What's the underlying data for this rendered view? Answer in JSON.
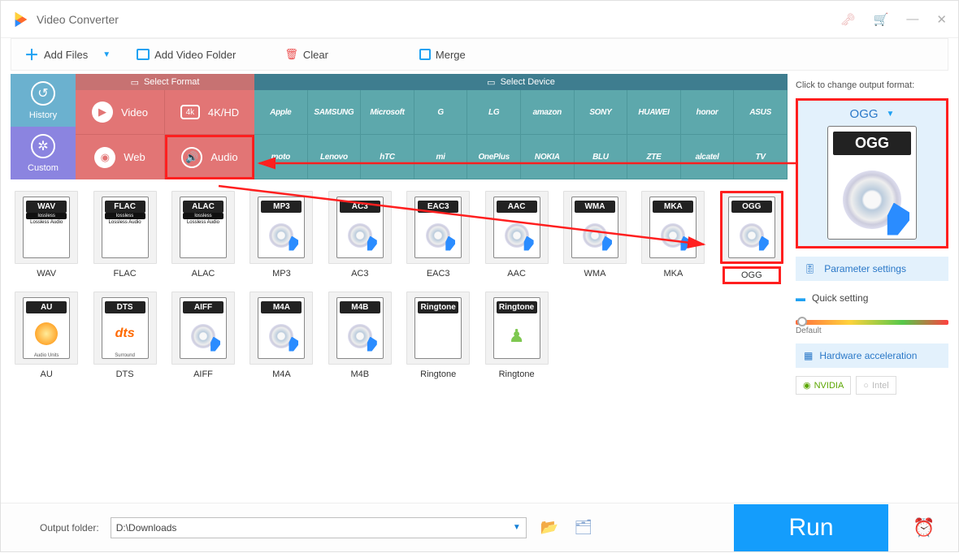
{
  "title": "Video Converter",
  "toolbar": {
    "add_files": "Add Files",
    "add_folder": "Add Video Folder",
    "clear": "Clear",
    "merge": "Merge"
  },
  "side": {
    "history": "History",
    "custom": "Custom"
  },
  "select_format_header": "Select Format",
  "select_device_header": "Select Device",
  "format_tabs": {
    "video": "Video",
    "khd": "4K/HD",
    "web": "Web",
    "audio": "Audio"
  },
  "devices_row1": [
    "Apple",
    "SAMSUNG",
    "Microsoft",
    "G",
    "LG",
    "amazon",
    "SONY",
    "HUAWEI",
    "honor",
    "ASUS"
  ],
  "devices_row2": [
    "moto",
    "Lenovo",
    "hTC",
    "mi",
    "OnePlus",
    "NOKIA",
    "BLU",
    "ZTE",
    "alcatel",
    "TV"
  ],
  "formats": [
    {
      "label": "WAV",
      "lossless": true
    },
    {
      "label": "FLAC",
      "lossless": true
    },
    {
      "label": "ALAC",
      "lossless": true
    },
    {
      "label": "MP3"
    },
    {
      "label": "AC3"
    },
    {
      "label": "EAC3"
    },
    {
      "label": "AAC"
    },
    {
      "label": "WMA"
    },
    {
      "label": "MKA"
    },
    {
      "label": "OGG",
      "selected": true
    },
    {
      "label": "AU",
      "sub": "Audio Units",
      "orange": true
    },
    {
      "label": "DTS",
      "sub": "Surround",
      "orange": true,
      "dts": true
    },
    {
      "label": "AIFF"
    },
    {
      "label": "M4A"
    },
    {
      "label": "M4B"
    },
    {
      "label": "Ringtone",
      "apple": true
    },
    {
      "label": "Ringtone",
      "android": true
    }
  ],
  "right": {
    "tip": "Click to change output format:",
    "selected": "OGG",
    "param": "Parameter settings",
    "quick": "Quick setting",
    "slider_label": "Default",
    "hw": "Hardware acceleration",
    "nvidia": "NVIDIA",
    "intel": "Intel"
  },
  "bottom": {
    "label": "Output folder:",
    "value": "D:\\Downloads",
    "run": "Run"
  }
}
